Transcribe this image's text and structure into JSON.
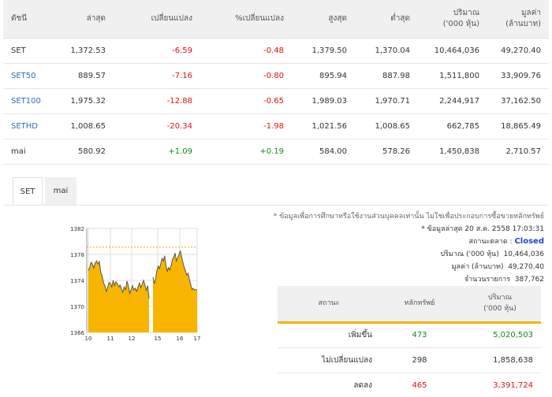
{
  "columns": [
    "ดัชนี",
    "ล่าสุด",
    "เปลี่ยนแปลง",
    "%เปลี่ยนแปลง",
    "สูงสุด",
    "ต่ำสุด",
    "ปริมาณ",
    "('000 หุ้น)",
    "มูลค่า",
    "(ล้านบาท)"
  ],
  "rows": [
    {
      "name": "SET",
      "last": "1,372.53",
      "chg": "-6.59",
      "pct": "-0.48",
      "high": "1,379.50",
      "low": "1,370.04",
      "vol": "10,464,036",
      "val": "49,270.40"
    },
    {
      "name": "SET50",
      "last": "889.57",
      "chg": "-7.16",
      "pct": "-0.80",
      "high": "895.94",
      "low": "887.98",
      "vol": "1,511,800",
      "val": "33,909.76"
    },
    {
      "name": "SET100",
      "last": "1,975.32",
      "chg": "-12.88",
      "pct": "-0.65",
      "high": "1,989.03",
      "low": "1,970.71",
      "vol": "2,244,917",
      "val": "37,162.50"
    },
    {
      "name": "SETHD",
      "last": "1,008.65",
      "chg": "-20.34",
      "pct": "-1.98",
      "high": "1,021.56",
      "low": "1,008.65",
      "vol": "662,785",
      "val": "18,865.49"
    },
    {
      "name": "mai",
      "last": "580.92",
      "chg": "+1.09",
      "pct": "+0.19",
      "high": "584.00",
      "low": "578.26",
      "vol": "1,450,838",
      "val": "2,710.57"
    }
  ],
  "tabs": [
    "SET",
    "mai"
  ],
  "info": {
    "note": "* ข้อมูลเพื่อการศึกษาหรือใช้งานส่วนบุคคลเท่านั้น ไม่ใช่เพื่อประกอบการซื้อขายหลักทรัพย์",
    "updated": "* ข้อมูลล่าสุด 20 ส.ค. 2558 17:03:31",
    "status_label": "สถานะตลาด :",
    "status_value": "Closed",
    "volume_label": "ปริมาณ ('000 หุ้น)",
    "volume_value": "10,464,036",
    "value_label": "มูลค่า (ล้านบาท)",
    "value_value": "49,270.40",
    "trades_label": "จำนวนรายการ",
    "trades_value": "387,762"
  },
  "status_table": {
    "headers": [
      "สถานะ",
      "หลักทรัพย์",
      "ปริมาณ",
      "('000 หุ้น)"
    ],
    "rows": [
      {
        "label": "เพิ่มขึ้น",
        "count": "473",
        "volume": "5,020,503",
        "color": "#118a11"
      },
      {
        "label": "ไม่เปลี่ยนแปลง",
        "count": "298",
        "volume": "1,858,638",
        "color": "#333333"
      },
      {
        "label": "ลดลง",
        "count": "465",
        "volume": "3,391,724",
        "color": "#d11111"
      }
    ]
  },
  "chart_data": {
    "type": "area",
    "y_ticks": [
      "1382",
      "1378",
      "1374",
      "1370",
      "1366"
    ],
    "x_ticks": [
      "10",
      "11",
      "12",
      "15",
      "16",
      "17"
    ],
    "ylim": [
      1366,
      1382
    ],
    "reference": 1379.12,
    "fill_color": "#f7b500",
    "line_color": "#555555",
    "ref_color": "#f0a000",
    "morning": [
      1375.5,
      1376.0,
      1376.8,
      1376.5,
      1375.9,
      1376.7,
      1377.0,
      1376.5,
      1376.9,
      1375.2,
      1374.7,
      1373.6,
      1373.2,
      1372.3,
      1372.9,
      1373.7,
      1373.5,
      1373.0,
      1374.0,
      1373.2,
      1373.8,
      1373.5,
      1373.0,
      1373.3,
      1372.7,
      1372.2,
      1373.0,
      1372.6,
      1373.9,
      1373.1,
      1372.0,
      1372.6,
      1373.2,
      1372.5,
      1372.8,
      1372.3,
      1373.0,
      1373.6,
      1372.9,
      1373.4,
      1374.0,
      1373.3,
      1372.4,
      1373.2,
      1371.2
    ],
    "afternoon": [
      1374.5,
      1373.5,
      1374.2,
      1375.5,
      1376.2,
      1375.8,
      1376.6,
      1377.4,
      1377.0,
      1377.8,
      1376.3,
      1375.4,
      1376.0,
      1375.6,
      1376.3,
      1377.2,
      1377.6,
      1378.2,
      1377.0,
      1377.5,
      1377.9,
      1378.6,
      1377.7,
      1376.8,
      1376.0,
      1375.5,
      1374.8,
      1375.1,
      1374.2,
      1373.4,
      1372.6,
      1372.8,
      1372.5,
      1372.6,
      1372.5
    ]
  }
}
